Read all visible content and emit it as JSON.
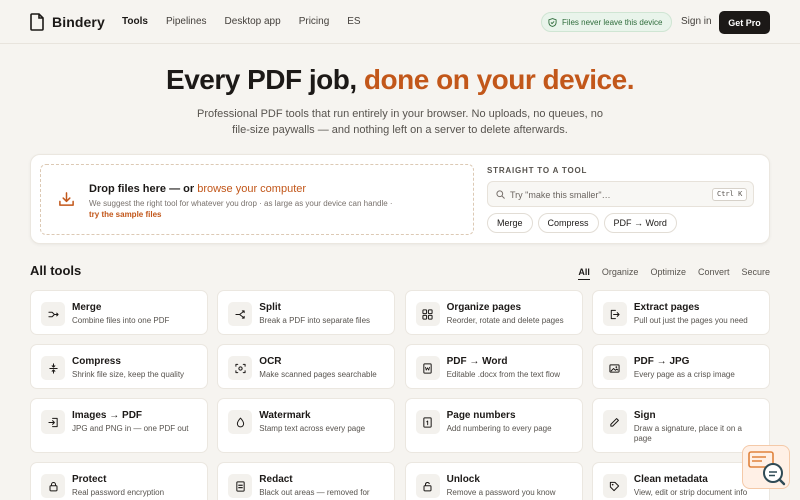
{
  "brand": {
    "name": "Bindery",
    "accent_color": "#c2571a",
    "ink_color": "#1c1917"
  },
  "nav": {
    "links": [
      "Tools",
      "Pipelines",
      "Desktop app",
      "Pricing",
      "ES"
    ],
    "privacy_pill": "Files never leave this device",
    "sign_in": "Sign in",
    "cta": "Get Pro"
  },
  "hero": {
    "title_start": "Every PDF job, ",
    "title_accent": "done on your device.",
    "subtitle": "Professional PDF tools that run entirely in your browser. No uploads, no queues, no file-size paywalls — and nothing left on a server to delete afterwards."
  },
  "upload": {
    "title": "Drop files here — or ",
    "browse_link": "browse your computer",
    "description": "We suggest the right tool for whatever you drop · as large as your device can handle ·",
    "sample_link": "try the sample files"
  },
  "quick": {
    "label": "STRAIGHT TO A TOOL",
    "search_placeholder": "Try \"make this smaller\"…",
    "shortcut": "Ctrl K",
    "chips": [
      "Merge",
      "Compress",
      "PDF → Word"
    ]
  },
  "tools_section": {
    "title": "All tools",
    "filters": [
      "All",
      "Organize",
      "Optimize",
      "Convert",
      "Secure"
    ],
    "tools": [
      {
        "name": "Merge",
        "desc": "Combine files into one PDF",
        "icon": "merge-icon"
      },
      {
        "name": "Split",
        "desc": "Break a PDF into separate files",
        "icon": "split-icon"
      },
      {
        "name": "Organize pages",
        "desc": "Reorder, rotate and delete pages",
        "icon": "grid-icon"
      },
      {
        "name": "Extract pages",
        "desc": "Pull out just the pages you need",
        "icon": "extract-icon"
      },
      {
        "name": "Compress",
        "desc": "Shrink file size, keep the quality",
        "icon": "compress-icon"
      },
      {
        "name": "OCR",
        "desc": "Make scanned pages searchable",
        "icon": "scan-icon"
      },
      {
        "name": "PDF → Word",
        "desc": "Editable .docx from the text flow",
        "icon": "word-icon"
      },
      {
        "name": "PDF → JPG",
        "desc": "Every page as a crisp image",
        "icon": "image-icon"
      },
      {
        "name": "Images → PDF",
        "desc": "JPG and PNG in — one PDF out",
        "icon": "import-icon"
      },
      {
        "name": "Watermark",
        "desc": "Stamp text across every page",
        "icon": "droplet-icon"
      },
      {
        "name": "Page numbers",
        "desc": "Add numbering to every page",
        "icon": "page-number-icon"
      },
      {
        "name": "Sign",
        "desc": "Draw a signature, place it on a page",
        "icon": "pen-icon"
      },
      {
        "name": "Protect",
        "desc": "Real password encryption",
        "icon": "lock-icon"
      },
      {
        "name": "Redact",
        "desc": "Black out areas — removed for",
        "icon": "redact-icon"
      },
      {
        "name": "Unlock",
        "desc": "Remove a password you know",
        "icon": "unlock-icon"
      },
      {
        "name": "Clean metadata",
        "desc": "View, edit or strip document info",
        "icon": "tag-icon"
      }
    ]
  }
}
